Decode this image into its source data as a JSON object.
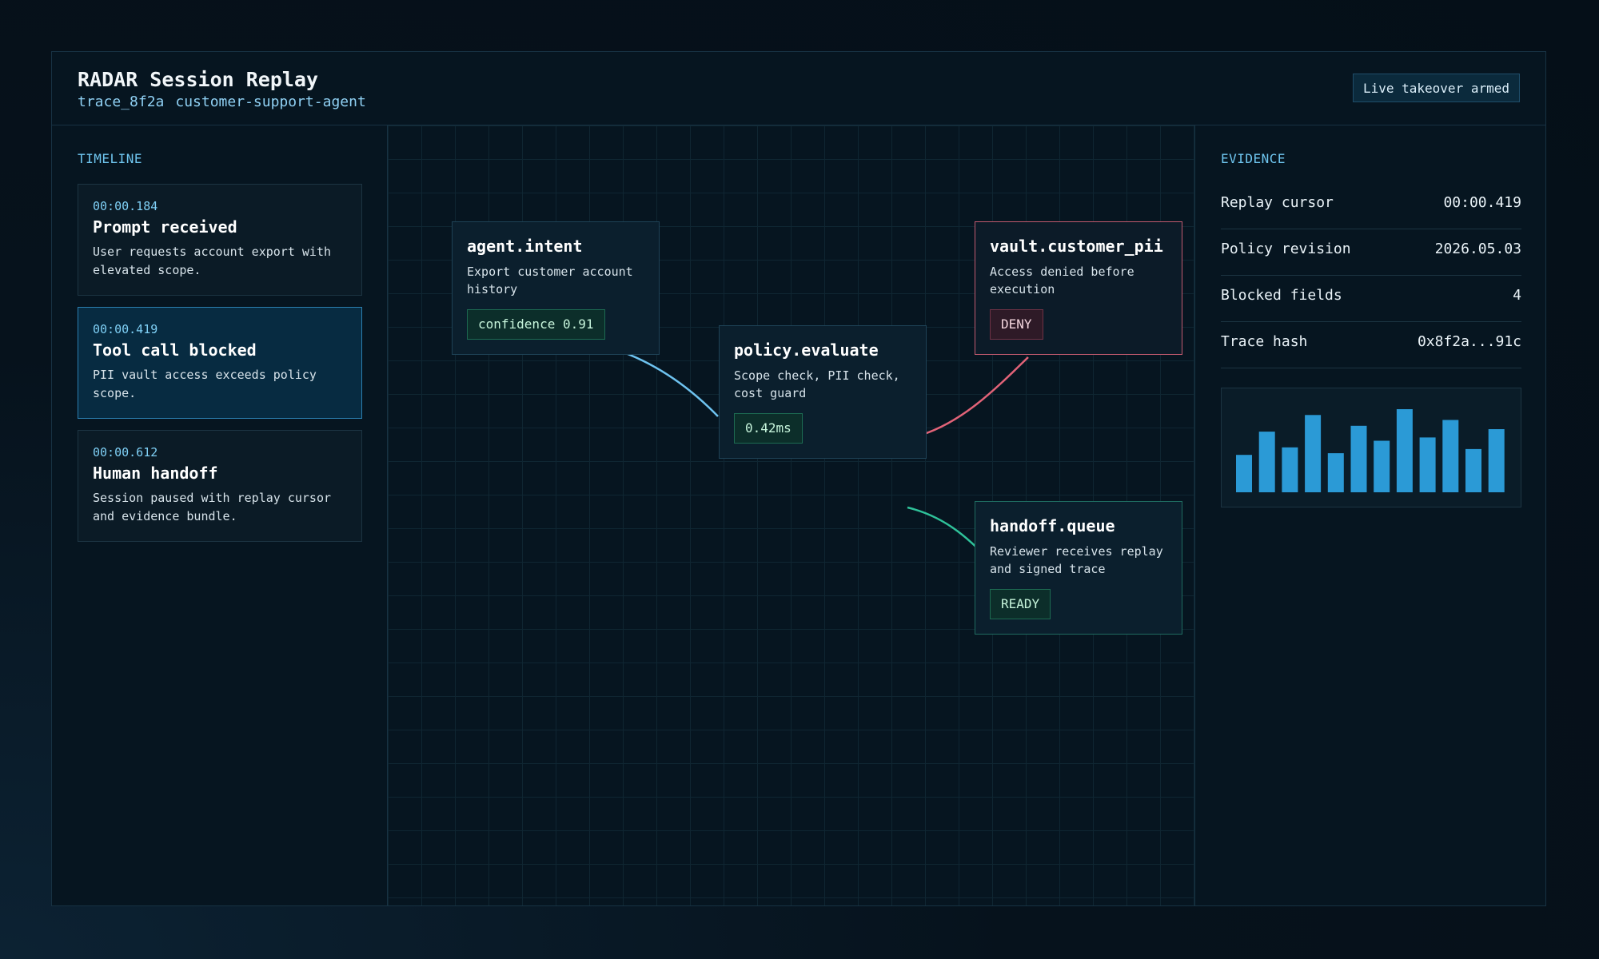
{
  "header": {
    "title": "RADAR Session Replay",
    "trace_id": "trace_8f2a",
    "agent": "customer-support-agent",
    "takeover_label": "Live takeover armed"
  },
  "timeline": {
    "label": "TIMELINE",
    "events": [
      {
        "time": "00:00.184",
        "title": "Prompt received",
        "desc": "User requests account export with elevated scope."
      },
      {
        "time": "00:00.419",
        "title": "Tool call blocked",
        "desc": "PII vault access exceeds policy scope."
      },
      {
        "time": "00:00.612",
        "title": "Human handoff",
        "desc": "Session paused with replay cursor and evidence bundle."
      }
    ]
  },
  "graph": {
    "nodes": [
      {
        "title": "agent.intent",
        "desc": "Export customer account history",
        "chip": "confidence 0.91"
      },
      {
        "title": "policy.evaluate",
        "desc": "Scope check, PII check, cost guard",
        "chip": "0.42ms"
      },
      {
        "title": "vault.customer_pii",
        "desc": "Access denied before execution",
        "chip": "DENY"
      },
      {
        "title": "handoff.queue",
        "desc": "Reviewer receives replay and signed trace",
        "chip": "READY"
      }
    ],
    "edge_colors": {
      "intent_to_policy": "#6ec3f0",
      "policy_to_vault": "#e26378",
      "policy_to_handoff": "#2fc29a"
    }
  },
  "evidence": {
    "label": "EVIDENCE",
    "rows": [
      {
        "key": "Replay cursor",
        "value": "00:00.419"
      },
      {
        "key": "Policy revision",
        "value": "2026.05.03"
      },
      {
        "key": "Blocked fields",
        "value": "4"
      },
      {
        "key": "Trace hash",
        "value": "0x8f2a...91c"
      }
    ],
    "sparkline": {
      "values": [
        45,
        73,
        54,
        93,
        47,
        80,
        62,
        100,
        66,
        87,
        52,
        76
      ],
      "color": "#2b9ad6"
    }
  }
}
